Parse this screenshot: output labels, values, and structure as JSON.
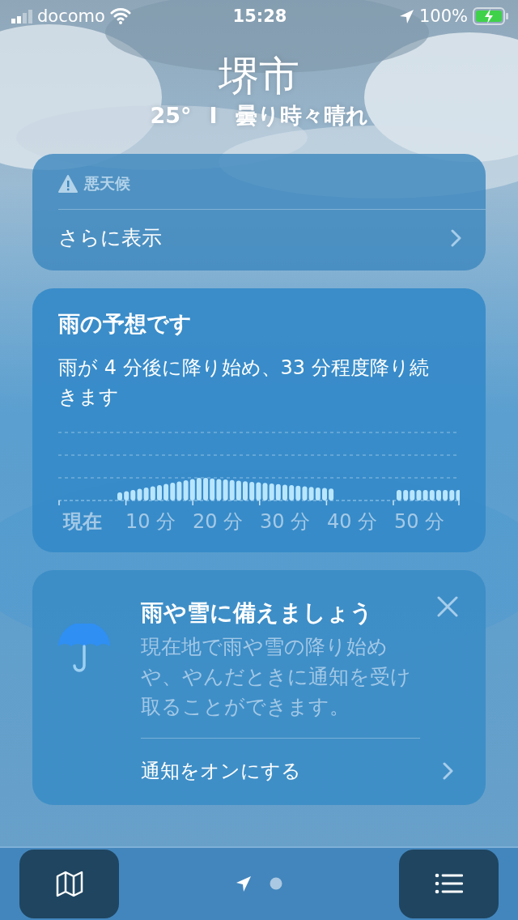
{
  "status_bar": {
    "carrier": "docomo",
    "time": "15:28",
    "battery": "100%"
  },
  "location": {
    "city": "堺市",
    "temperature": "25°",
    "separator": "I",
    "condition": "曇り時々晴れ"
  },
  "alert_card": {
    "title": "悪天候",
    "link": "さらに表示"
  },
  "rain_card": {
    "title": "雨の予想です",
    "description": "雨が 4 分後に降り始め、33 分程度降り続きます",
    "axis_labels": [
      "現在",
      "10 分",
      "20 分",
      "30 分",
      "40 分",
      "50 分"
    ]
  },
  "notify_card": {
    "title": "雨や雪に備えましょう",
    "description": "現在地で雨や雪の降り始めや、やんだときに通知を受け取ることができます。",
    "action": "通知をオンにする"
  },
  "pages": [
    {
      "kind": "location",
      "selected": true
    },
    {
      "kind": "dot",
      "selected": false
    }
  ]
}
